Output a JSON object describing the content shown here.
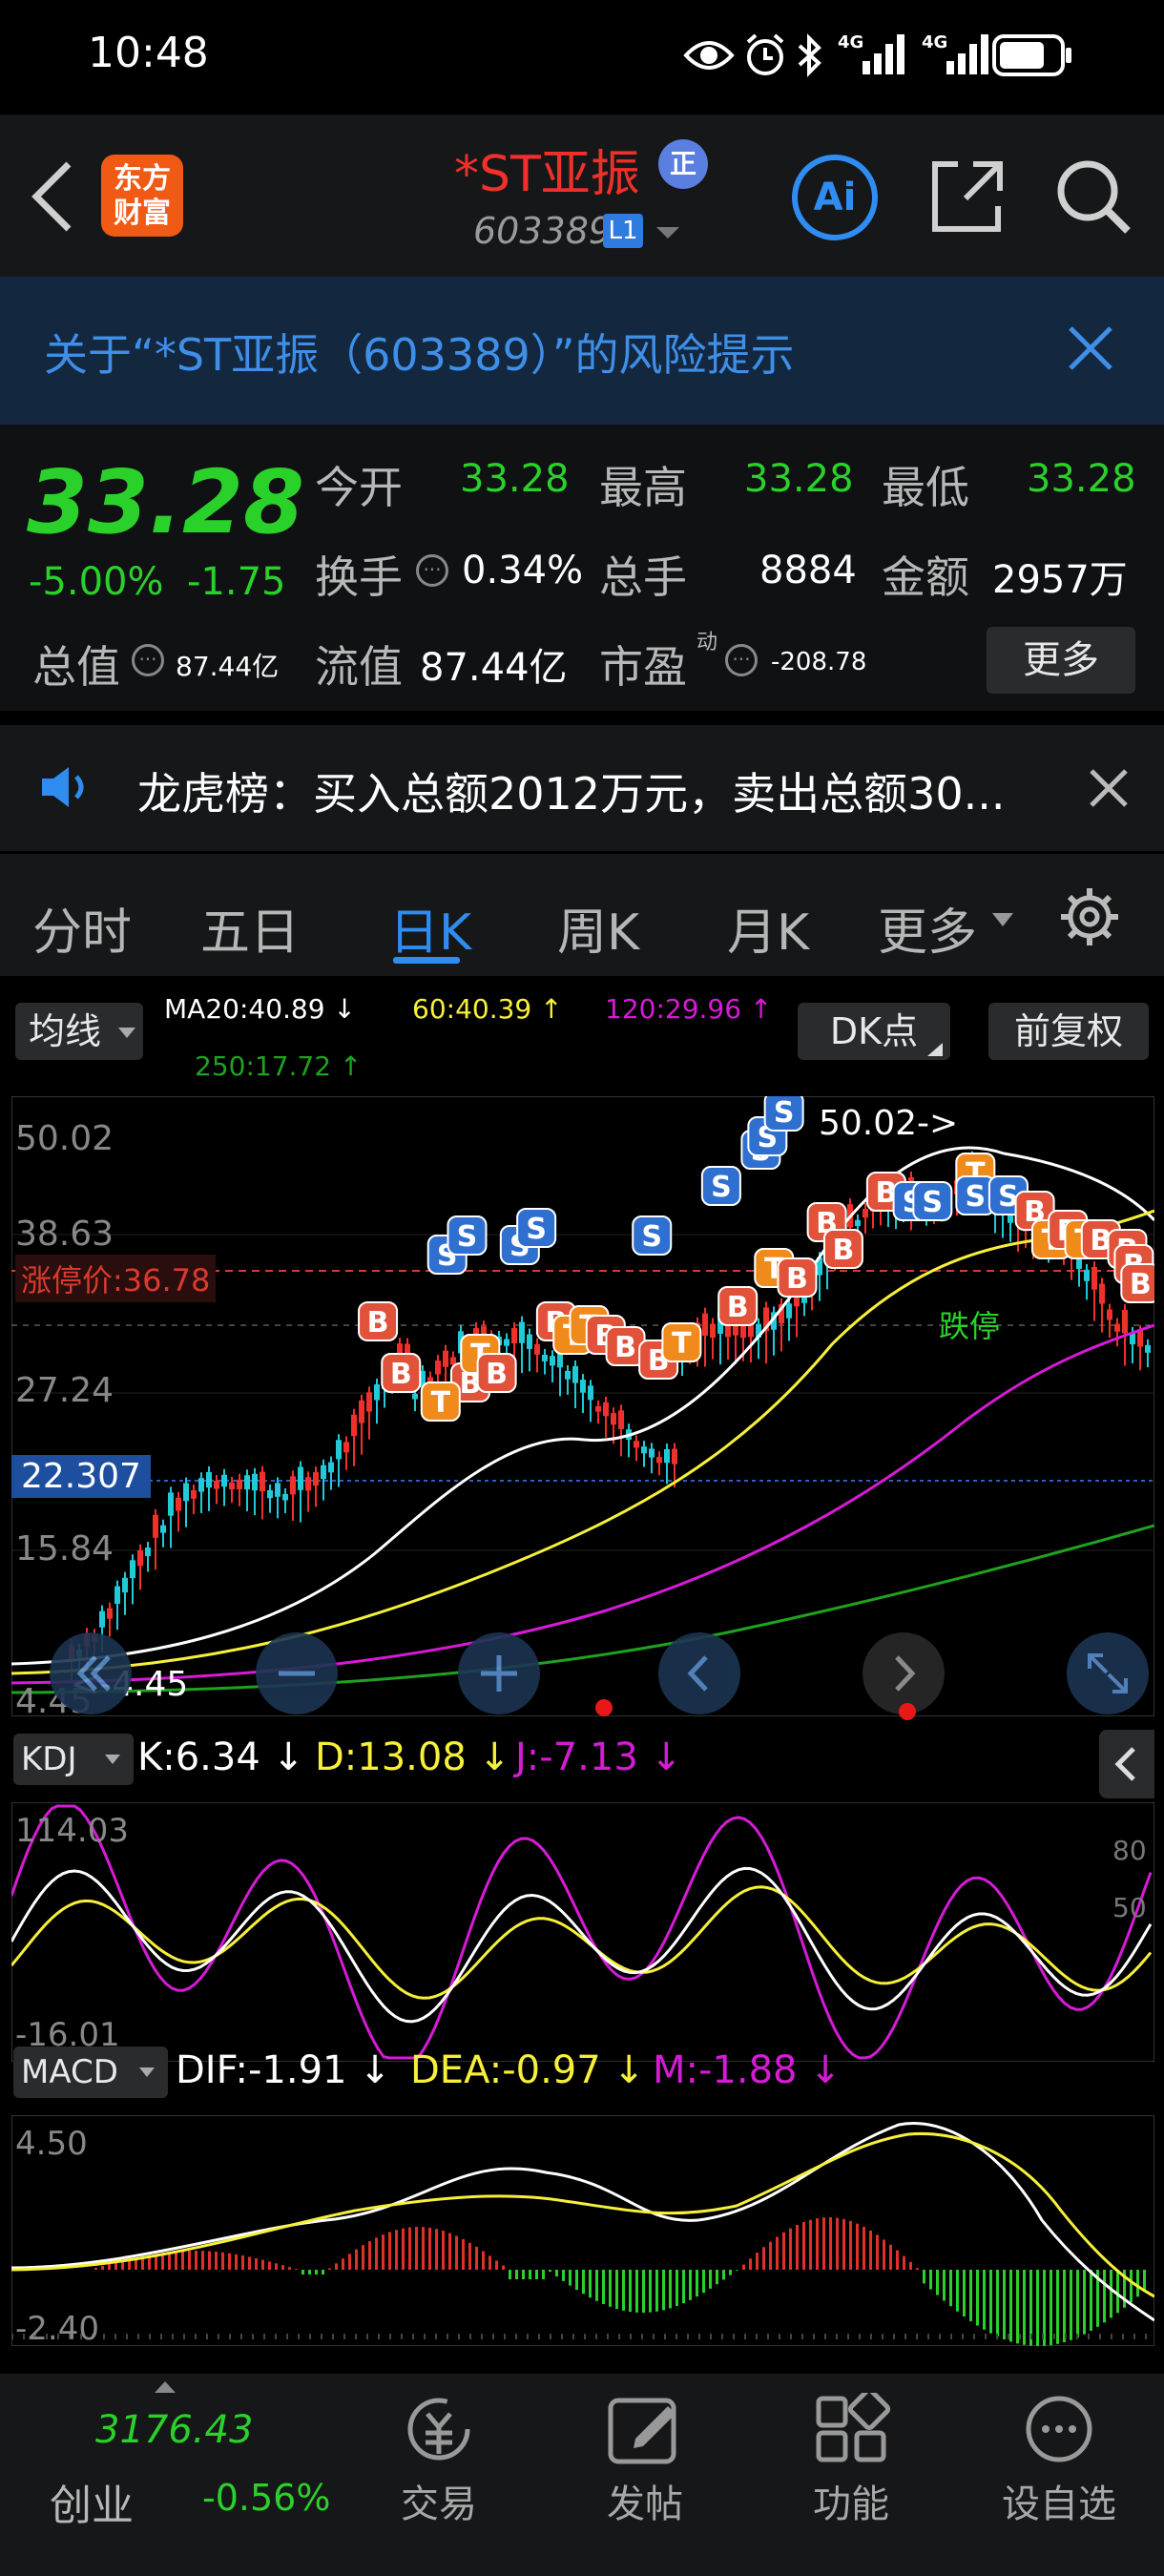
{
  "status_bar": {
    "time": "10:48",
    "net1": "4G",
    "net2": "4G"
  },
  "header": {
    "app_logo": "东方\n财富",
    "stock_name": "*ST亚振",
    "badge": "正",
    "code": "603389",
    "level": "L1",
    "ai_label": "Ai"
  },
  "risk_banner": {
    "text": "关于“*ST亚振（603389）”的风险提示"
  },
  "quote": {
    "price": "33.28",
    "change_pct": "-5.00%",
    "change": "-1.75",
    "open_label": "今开",
    "open": "33.28",
    "high_label": "最高",
    "high": "33.28",
    "low_label": "最低",
    "low": "33.28",
    "turnover_label": "换手",
    "turnover": "0.34%",
    "volume_label": "总手",
    "volume": "8884",
    "amount_label": "金额",
    "amount": "2957万",
    "mcap_label": "总值",
    "mcap": "87.44亿",
    "float_label": "流值",
    "float": "87.44亿",
    "pe_label": "市盈",
    "pe_sup": "动",
    "pe": "-208.78",
    "more_button": "更多"
  },
  "notice": {
    "text": "龙虎榜：买入总额2012万元，卖出总额30..."
  },
  "tabs": [
    {
      "label": "分时"
    },
    {
      "label": "五日"
    },
    {
      "label": "日K"
    },
    {
      "label": "周K"
    },
    {
      "label": "月K"
    },
    {
      "label": "更多"
    }
  ],
  "indicators": {
    "ma_select": "均线",
    "ma20": "MA20:40.89 ↓",
    "ma60": "60:40.39 ↑",
    "ma120": "120:29.96 ↑",
    "ma250": "250:17.72 ↑",
    "dk_select": "DK点",
    "adjust_button": "前复权"
  },
  "main_chart": {
    "y_labels": [
      "50.02",
      "38.63",
      "27.24",
      "15.84",
      "4.45"
    ],
    "limit_up_label": "涨停价:36.78",
    "cursor_price": "22.307",
    "high_annotation": "50.02->",
    "low_annotation": "<-4.45",
    "limit_tag": "跌停"
  },
  "kdj": {
    "select": "KDJ",
    "k": "K:6.34 ↓",
    "d": "D:13.08 ↓",
    "j": "J:-7.13 ↓",
    "y_top": "114.03",
    "y_bottom": "-16.01",
    "r80": "80",
    "r50": "50"
  },
  "macd": {
    "select": "MACD",
    "dif": "DIF:-1.91 ↓",
    "dea": "DEA:-0.97 ↓",
    "m": "M:-1.88 ↓",
    "y_top": "4.50",
    "y_bottom": "-2.40"
  },
  "bottom_nav": {
    "index_value": "3176.43",
    "index_name": "创业",
    "index_change": "-0.56%",
    "trade": "交易",
    "post": "发帖",
    "functions": "功能",
    "watchlist": "设自选"
  },
  "colors": {
    "up": "#f0302a",
    "down": "#2bd12b",
    "accent": "#2f8df2",
    "ma20": "#ffffff",
    "ma60": "#f7f03a",
    "ma120": "#d61bd6",
    "ma250": "#1fa31f"
  }
}
